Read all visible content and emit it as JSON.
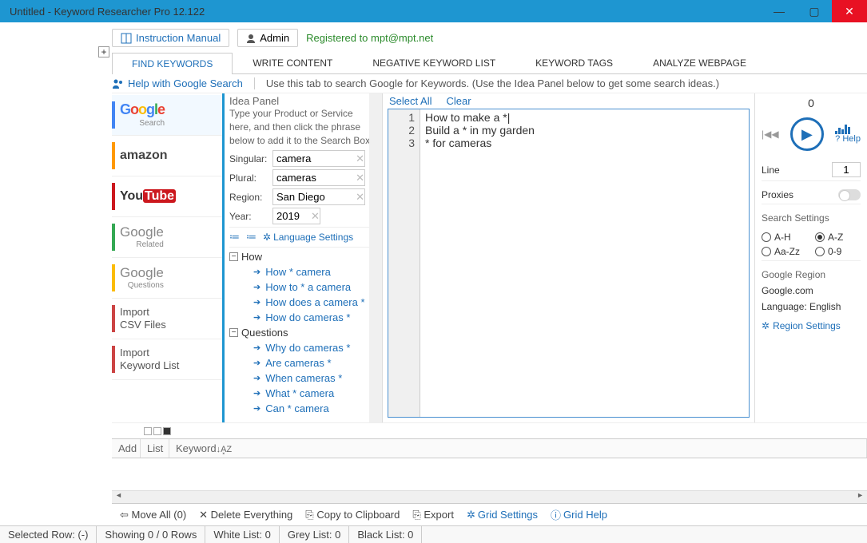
{
  "window_title": "Untitled - Keyword Researcher Pro 12.122",
  "topbar": {
    "manual": "Instruction Manual",
    "admin": "Admin",
    "registered": "Registered to mpt@mpt.net"
  },
  "tabs": [
    "FIND KEYWORDS",
    "WRITE CONTENT",
    "NEGATIVE KEYWORD LIST",
    "KEYWORD TAGS",
    "ANALYZE WEBPAGE"
  ],
  "active_tab": 0,
  "subheader": {
    "help": "Help with Google Search",
    "desc": "Use this tab to search Google for Keywords. (Use the Idea Panel below to get some search ideas.)"
  },
  "sources": [
    {
      "name": "Google",
      "sub": "Search",
      "bar": "bar-google",
      "active": true
    },
    {
      "name": "amazon",
      "bar": "bar-amazon"
    },
    {
      "name": "YouTube",
      "bar": "bar-youtube"
    },
    {
      "name": "Google",
      "sub": "Related",
      "bar": "bar-related",
      "grey": true
    },
    {
      "name": "Google",
      "sub": "Questions",
      "bar": "bar-questions",
      "grey": true
    },
    {
      "name": "Import",
      "sub2": "CSV Files",
      "bar": "bar-import"
    },
    {
      "name": "Import",
      "sub2": "Keyword List",
      "bar": "bar-import"
    }
  ],
  "idea": {
    "title": "Idea Panel",
    "desc": "Type your Product or Service here, and then click the phrase below to add it to the Search Box.",
    "singular_lbl": "Singular:",
    "singular": "camera",
    "plural_lbl": "Plural:",
    "plural": "cameras",
    "region_lbl": "Region:",
    "region": "San Diego",
    "year_lbl": "Year:",
    "year": "2019",
    "lang_settings": "Language Settings",
    "groups": [
      {
        "name": "How",
        "items": [
          "How * camera",
          "How to * a camera",
          "How does a camera *",
          "How do cameras *"
        ]
      },
      {
        "name": "Questions",
        "items": [
          "Why do cameras *",
          "Are cameras *",
          "When cameras *",
          "What * camera",
          "Can * camera"
        ]
      }
    ]
  },
  "editor": {
    "select_all": "Select All",
    "clear": "Clear",
    "lines": [
      "How to make a *",
      "Build a * in my garden",
      "* for cameras"
    ]
  },
  "right": {
    "count": "0",
    "help": "Help",
    "line_lbl": "Line",
    "line": "1",
    "proxies": "Proxies",
    "search_settings": "Search Settings",
    "radios": [
      "A-H",
      "A-Z",
      "Aa-Zz",
      "0-9"
    ],
    "radio_selected": 1,
    "region_title": "Google Region",
    "domain": "Google.com",
    "lang": "Language: English",
    "region_settings": "Region Settings"
  },
  "grid_headers": [
    "Add",
    "List",
    "Keyword"
  ],
  "toolbar2": {
    "move": "Move All (0)",
    "del": "Delete Everything",
    "copy": "Copy to Clipboard",
    "export": "Export",
    "grid_settings": "Grid Settings",
    "grid_help": "Grid Help"
  },
  "status": {
    "row": "Selected Row: (-)",
    "showing": "Showing 0 / 0 Rows",
    "white": "White List: 0",
    "grey": "Grey List: 0",
    "black": "Black List: 0"
  }
}
